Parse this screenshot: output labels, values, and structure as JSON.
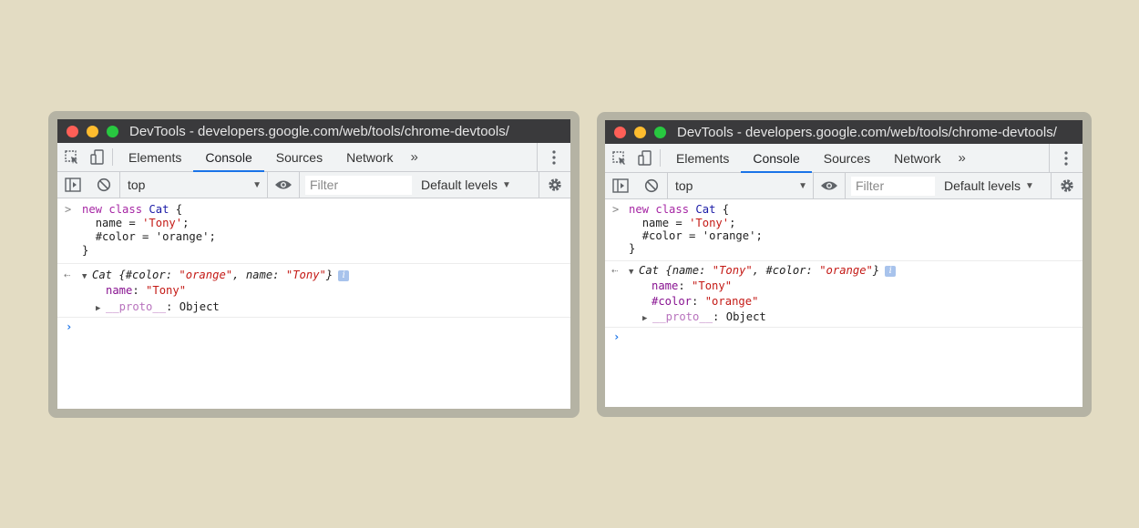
{
  "windows": [
    {
      "title": "DevTools - developers.google.com/web/tools/chrome-devtools/",
      "tabs": [
        "Elements",
        "Console",
        "Sources",
        "Network"
      ],
      "more_tabs": "»",
      "context": "top",
      "filter_placeholder": "Filter",
      "levels": "Default levels",
      "input": {
        "l1_kw1": "new",
        "l1_kw2": "class",
        "l1_cls": "Cat",
        "l1_brace": " {",
        "l2_name": "name",
        "l2_eq": " = ",
        "l2_val": "'Tony'",
        "l2_semi": ";",
        "l3_name": "#color",
        "l3_eq": " = ",
        "l3_val": "'orange'",
        "l3_semi": ";",
        "l4": "}"
      },
      "summary": {
        "cls": "Cat",
        "open": " {",
        "k1": "#color",
        "v1": "\"orange\"",
        "k2": "name",
        "v2": "\"Tony\"",
        "close": "}"
      },
      "props": [
        {
          "key": "name",
          "value": "\"Tony\""
        }
      ],
      "proto": {
        "key": "__proto__",
        "value": "Object"
      }
    },
    {
      "title": "DevTools - developers.google.com/web/tools/chrome-devtools/",
      "tabs": [
        "Elements",
        "Console",
        "Sources",
        "Network"
      ],
      "more_tabs": "»",
      "context": "top",
      "filter_placeholder": "Filter",
      "levels": "Default levels",
      "input": {
        "l1_kw1": "new",
        "l1_kw2": "class",
        "l1_cls": "Cat",
        "l1_brace": " {",
        "l2_name": "name",
        "l2_eq": " = ",
        "l2_val": "'Tony'",
        "l2_semi": ";",
        "l3_name": "#color",
        "l3_eq": " = ",
        "l3_val": "'orange'",
        "l3_semi": ";",
        "l4": "}"
      },
      "summary": {
        "cls": "Cat",
        "open": " {",
        "k1": "name",
        "v1": "\"Tony\"",
        "k2": "#color",
        "v2": "\"orange\"",
        "close": "}"
      },
      "props": [
        {
          "key": "name",
          "value": "\"Tony\""
        },
        {
          "key": "#color",
          "value": "\"orange\""
        }
      ],
      "proto": {
        "key": "__proto__",
        "value": "Object"
      }
    }
  ],
  "icons": {
    "inspect": "inspect-element-icon",
    "device": "device-toolbar-icon",
    "sidebar": "show-sidebar-icon",
    "clear": "clear-console-icon",
    "eye": "live-expression-eye-icon",
    "gear": "settings-gear-icon",
    "kebab": "more-options-icon",
    "info": "info-icon"
  },
  "colors": {
    "background": "#e3dcc3",
    "frame": "#b5b3a4",
    "titlebar": "#3a3a3c",
    "active_tab": "#1a73e8",
    "string": "#c41a16",
    "keyword": "#a626a4",
    "property": "#881391"
  }
}
